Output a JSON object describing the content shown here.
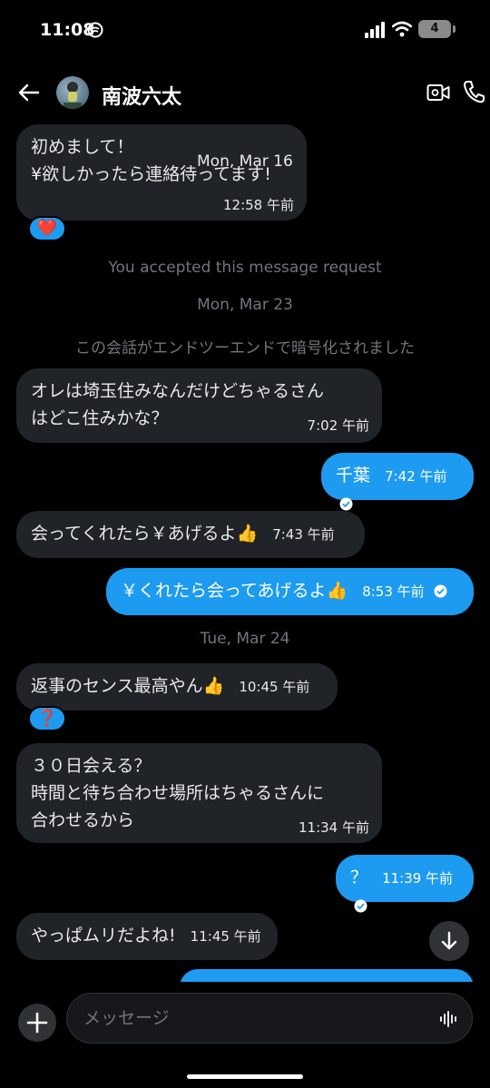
{
  "status": {
    "time": "11:08",
    "battery": "4"
  },
  "header": {
    "contact_name": "南波六太"
  },
  "messages": [
    {
      "text": "初めまして！\n¥欲しかったら連絡待ってます!",
      "date_overlay": "Mon, Mar 16",
      "time": "12:58 午前",
      "reaction": "❤️"
    },
    {
      "text": "オレは埼玉住みなんだけどちゃるさん\nはどこ住みかな？",
      "time": "7:02 午前"
    },
    {
      "text": "千葉",
      "time": "7:42 午前"
    },
    {
      "text": "会ってくれたら￥あげるよ👍",
      "time": "7:43 午前"
    },
    {
      "text": "￥くれたら会ってあげるよ👍",
      "time": "8:53 午前"
    },
    {
      "text": "返事のセンス最高やん👍",
      "time": "10:45 午前",
      "reaction": "❓"
    },
    {
      "text": "３０日会える？\n時間と待ち合わせ場所はちゃるさんに\n合わせるから",
      "time": "11:34 午前"
    },
    {
      "text": "？",
      "time": "11:39 午前"
    },
    {
      "text": "やっぱムリだよね!",
      "time": "11:45 午前"
    }
  ],
  "system": {
    "accepted": "You accepted this message request",
    "date_mar23": "Mon, Mar 23",
    "encrypted": "この会話がエンドツーエンドで暗号化されました",
    "date_mar24": "Tue, Mar 24"
  },
  "composer": {
    "placeholder": "メッセージ"
  },
  "colors": {
    "accent": "#1d9bf0",
    "incoming_bubble": "#202327",
    "background": "#000000",
    "muted_text": "#71767b"
  },
  "icons": [
    "back-arrow-icon",
    "video-call-icon",
    "phone-icon",
    "plus-icon",
    "voice-wave-icon",
    "chevron-down-icon",
    "read-check-icon"
  ]
}
